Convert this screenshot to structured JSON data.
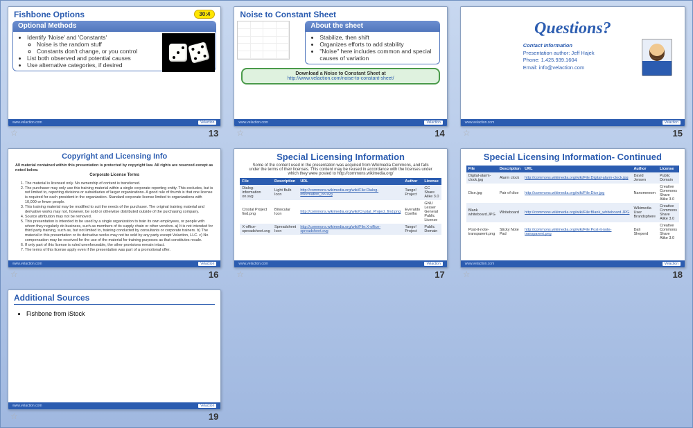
{
  "slides": [
    {
      "num": "13",
      "title": "Fishbone Options",
      "badge": "30:4",
      "box_title": "Optional Methods",
      "bullets": [
        "Identify 'Noise' and 'Constants'",
        "Noise is the random stuff",
        "Constants don't change, or you control",
        "List both observed and potential causes",
        "Use alternative categories, if desired"
      ]
    },
    {
      "num": "14",
      "title": "Noise to Constant Sheet",
      "box_title": "About  the sheet",
      "bullets": [
        "Stabilize, then shift",
        "Organizes efforts to add stability",
        "\"Noise\" here includes common and special causes of variation"
      ],
      "download_l1": "Download a Noise to Constant Sheet at",
      "download_l2": "http://www.velaction.com/noise-to-constant-sheet/"
    },
    {
      "num": "15",
      "q_title": "Questions?",
      "ci_head": "Contact Information",
      "ci_author": "Presentation author: Jeff Hajek",
      "ci_phone": "Phone: 1.425.939.1604",
      "ci_email": "Email: info@velaction.com"
    },
    {
      "num": "16",
      "title": "Copyright and Licensing Info",
      "lead": "All material contained within this presentation is protected by copyright law. All rights are reserved except as noted below.",
      "terms_head": "Corporate License Terms",
      "terms": [
        "The material is licensed only. No ownership of content is transferred.",
        "The purchaser may only use this training material within a single corporate reporting entity. This excludes, but is not limited to, reporting divisions or subsidiaries of larger organizations. A good rule of thumb is that one license is required for each president in the organization. Standard corporate license limited to organizations with 10,000 or fewer people.",
        "This training material may be modified to suit the needs of the purchaser. The original training material and derivative works may not, however, be sold or otherwise distributed outside of the purchasing company.",
        "Source attribution may not be removed.",
        "This presentation is intended to be used by a single organization to train its own employees, or people with whom they regularly do business, such as members of its supply chain or other vendors. a) It is not intended for third party training, such as, but not limited to, training conducted by consultants or corporate trainers. b) The material in this presentation or its derivative works may not be sold by any party except Velaction, LLC. c) No compensation may be received for the use of the material for training purposes as that constitutes resale.",
        "If only part of this license is ruled unenforceable, the other provisions remain intact.",
        "The terms of this license apply even if the presentation was part of a promotional offer."
      ]
    },
    {
      "num": "17",
      "title": "Special Licensing Information",
      "intro": "Some of the content used in the presentation was acquired from Wikimedia Commons, and falls under the terms of their licenses. This content may be reused in accordance with the licenses under which they were posted to http://commons.wikimedia.org/",
      "cols": [
        "File",
        "Description",
        "URL",
        "Author",
        "License"
      ],
      "rows": [
        [
          "Dialog-information on.svg",
          "Light Bulb Icon",
          "http://commons.wikimedia.org/wiki/File:Dialog-information_on.svg",
          "Tango! Project",
          "CC Share Alike 3.0"
        ],
        [
          "Crystal Project find.png",
          "Binocular Icon",
          "http://commons.wikimedia.org/wiki/Crystal_Project_find.png",
          "Everaldo Coelho",
          "GNU Lesser General Public License"
        ],
        [
          "X-office-spreadsheet.svg",
          "Spreadsheet Icon",
          "http://commons.wikimedia.org/wiki/File:X-office-spreadsheet.svg",
          "Tango! Project",
          "Public Domain"
        ]
      ]
    },
    {
      "num": "18",
      "title": "Special Licensing Information- Continued",
      "cols": [
        "File",
        "Description",
        "URL",
        "Author",
        "License"
      ],
      "rows": [
        [
          "Digital-alarm-clock.jpg",
          "Alarm clock",
          "http://commons.wikimedia.org/wiki/File:Digital-alarm-clock.jpg",
          "David Jensen",
          "Public Domain"
        ],
        [
          "Dice.jpg",
          "Pair of dice",
          "http://commons.wikimedia.org/wiki/File:Dice.jpg",
          "Nanomenom",
          "Creative Commons Share Alike 3.0"
        ],
        [
          "Blank whiteboard.JPG",
          "Whiteboard",
          "http://commons.wikimedia.org/wiki/File:Blank_whiteboard.JPG",
          "Wikimedia User Brandsphere",
          "Creative Commons Share Alike 3.0"
        ],
        [
          "Post-it-note-transparent.png",
          "Sticky Note Pad",
          "http://commons.wikimedia.org/wiki/File:Post-it-note-transparent.png",
          "Dali Sheperd",
          "Creative Commons Share Alike 3.0"
        ]
      ]
    },
    {
      "num": "19",
      "title": "Additional Sources",
      "bullets": [
        "Fishbone from iStock"
      ]
    }
  ],
  "footer": {
    "site": "www.velaction.com",
    "brand": "Velaction"
  }
}
